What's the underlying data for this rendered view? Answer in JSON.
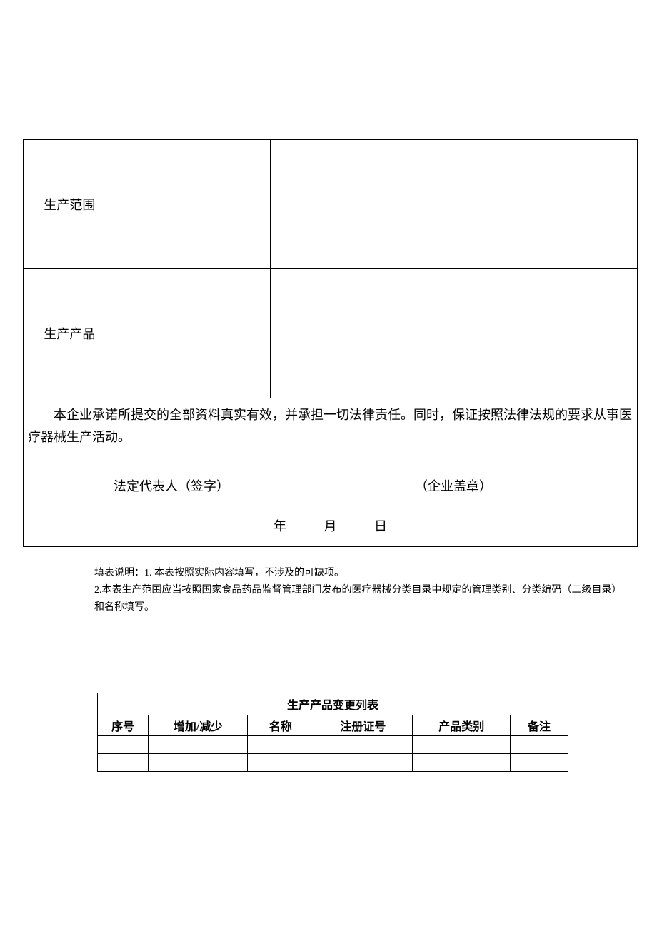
{
  "main_table": {
    "row1_label": "生产范围",
    "row2_label": "生产产品",
    "commitment_text": "本企业承诺所提交的全部资料真实有效，并承担一切法律责任。同时，保证按照法律法规的要求从事医疗器械生产活动。",
    "signature_left": "法定代表人（签字）",
    "signature_right": "（企业盖章）",
    "date_year": "年",
    "date_month": "月",
    "date_day": "日"
  },
  "instructions": {
    "line1": "填表说明：1. 本表按照实际内容填写，不涉及的可缺项。",
    "line2": "2.本表生产范围应当按照国家食品药品监督管理部门发布的医疗器械分类目录中规定的管理类别、分类编码（二级目录）和名称填写。"
  },
  "change_table": {
    "title": "生产产品变更列表",
    "headers": [
      "序号",
      "增加/减少",
      "名称",
      "注册证号",
      "产品类别",
      "备注"
    ],
    "rows": [
      [
        "",
        "",
        "",
        "",
        "",
        ""
      ],
      [
        "",
        "",
        "",
        "",
        "",
        ""
      ]
    ]
  }
}
